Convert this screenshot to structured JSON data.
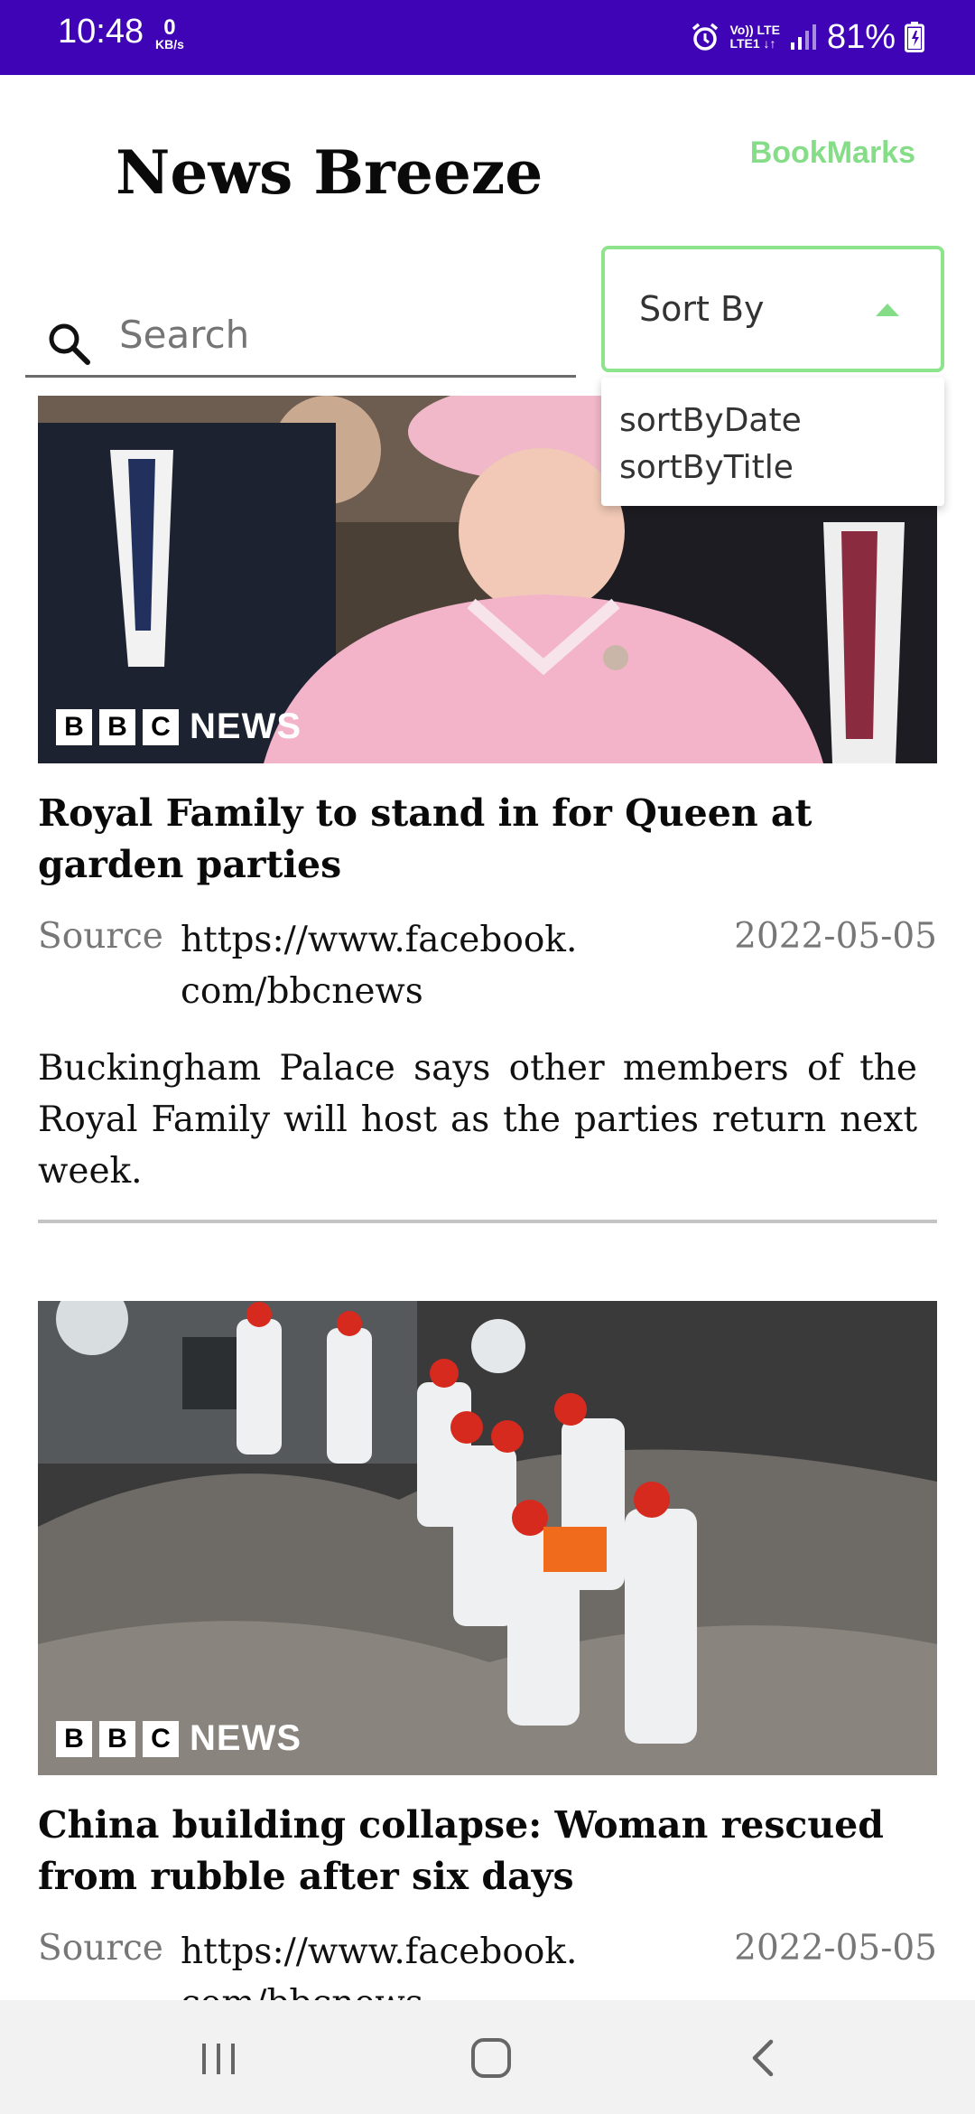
{
  "status_bar": {
    "time": "10:48",
    "speed_value": "0",
    "speed_unit": "KB/s",
    "network_top": "Vo)) LTE",
    "network_bottom": "LTE1 ↓↑",
    "battery": "81%",
    "icons": [
      "alarm-icon",
      "signal-icon",
      "battery-icon"
    ]
  },
  "header": {
    "title": "News Breeze",
    "bookmarks_label": "BookMarks"
  },
  "search": {
    "placeholder": "Search",
    "icon": "search-icon"
  },
  "sort": {
    "label": "Sort By",
    "expanded": true,
    "options": [
      "sortByDate",
      "sortByTitle"
    ]
  },
  "articles": [
    {
      "image_badge": {
        "letters": [
          "B",
          "B",
          "C"
        ],
        "news": "NEWS"
      },
      "title": "Royal Family to stand in for Queen at garden parties",
      "source_label": "Source",
      "source_url": "https://www.facebook.com/bbcnews",
      "date": "2022-05-05",
      "description": "Buckingham Palace says other members of the Royal Family will host as the parties return next week."
    },
    {
      "image_badge": {
        "letters": [
          "B",
          "B",
          "C"
        ],
        "news": "NEWS"
      },
      "title": "China building collapse: Woman rescued from rubble after six days",
      "source_label": "Source",
      "source_url": "https://www.facebook.com/bbcnews",
      "date": "2022-05-05"
    }
  ],
  "colors": {
    "status_bar": "#3f04b6",
    "accent_green": "#86dd88",
    "meta_gray": "#777777"
  },
  "nav_bar": {
    "icons": [
      "recents-icon",
      "home-icon",
      "back-icon"
    ]
  }
}
